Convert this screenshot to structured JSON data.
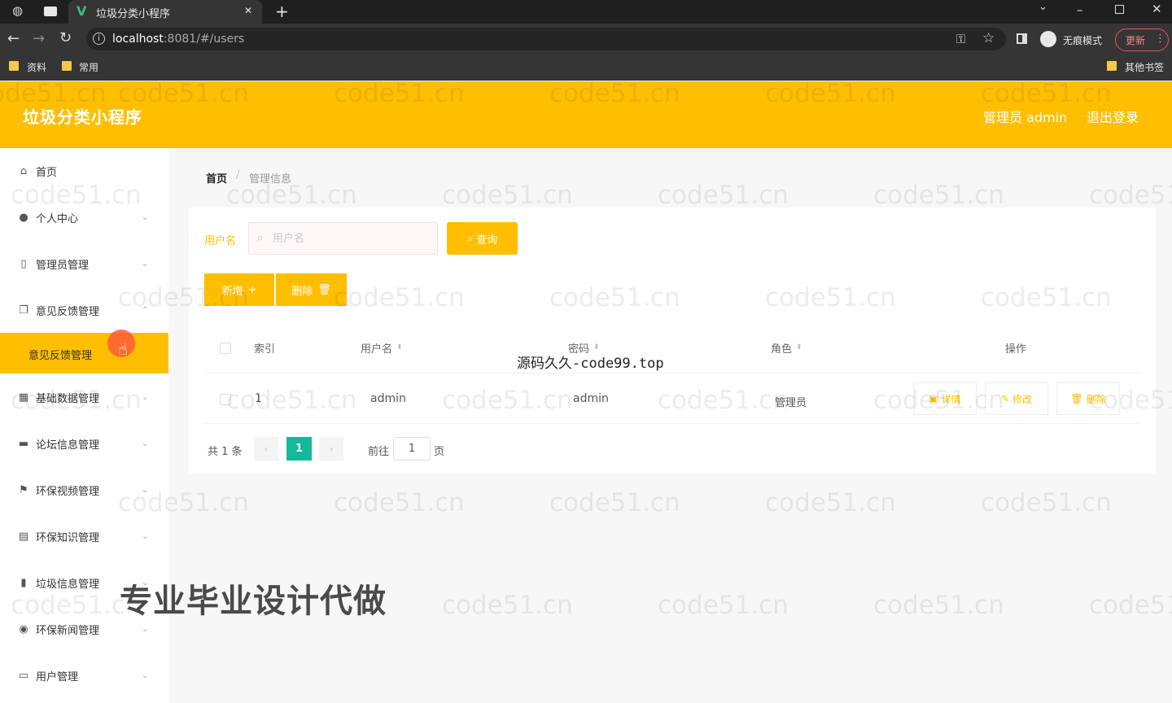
{
  "browser": {
    "tab_title": "垃圾分类小程序",
    "tab_close": "✕",
    "new_tab": "+",
    "url_host": "localhost",
    "url_rest": ":8081/#/users",
    "incognito_label": "无痕模式",
    "update_label": "更新",
    "bookmarks": [
      "资料",
      "常用"
    ],
    "other_bookmarks": "其他书签"
  },
  "header": {
    "brand": "垃圾分类小程序",
    "admin_label": "管理员 admin",
    "logout_label": "退出登录"
  },
  "sidebar": {
    "items": [
      {
        "label": "首页",
        "icon": "home-icon"
      },
      {
        "label": "个人中心",
        "icon": "user-icon"
      },
      {
        "label": "管理员管理",
        "icon": "phone-icon"
      },
      {
        "label": "意见反馈管理",
        "icon": "copy-icon"
      },
      {
        "label": "基础数据管理",
        "icon": "grid-icon"
      },
      {
        "label": "论坛信息管理",
        "icon": "monitor-icon"
      },
      {
        "label": "环保视频管理",
        "icon": "flag-icon"
      },
      {
        "label": "环保知识管理",
        "icon": "notebook-icon"
      },
      {
        "label": "垃圾信息管理",
        "icon": "bar-chart-icon"
      },
      {
        "label": "环保新闻管理",
        "icon": "location-icon"
      },
      {
        "label": "用户管理",
        "icon": "message-icon"
      }
    ],
    "active_submenu": "意见反馈管理"
  },
  "breadcrumb": {
    "home": "首页",
    "separator": "/",
    "current": "管理信息"
  },
  "filter": {
    "label": "用户名",
    "placeholder": "用户名",
    "query_label": "查询"
  },
  "actions": {
    "add_label": "新增",
    "delete_label": "删除"
  },
  "table": {
    "headers": {
      "index": "索引",
      "username": "用户名",
      "password": "密码",
      "role": "角色",
      "operation": "操作"
    },
    "rows": [
      {
        "index": "1",
        "username": "admin",
        "password": "admin",
        "role": "管理员"
      }
    ],
    "op_labels": {
      "detail": "详情",
      "edit": "修改",
      "delete": "删除"
    }
  },
  "pagination": {
    "total": "共 1 条",
    "current_page": "1",
    "goto_label": "前往",
    "goto_value": "1",
    "page_suffix": "页"
  },
  "overlays": {
    "watermark": "code51.cn",
    "code_text": "源码久久-code99.top",
    "ad_text": "专业毕业设计代做"
  },
  "colors": {
    "accent": "#ffbf00",
    "page_active": "#16b89c",
    "cursor": "#ff5a36"
  }
}
